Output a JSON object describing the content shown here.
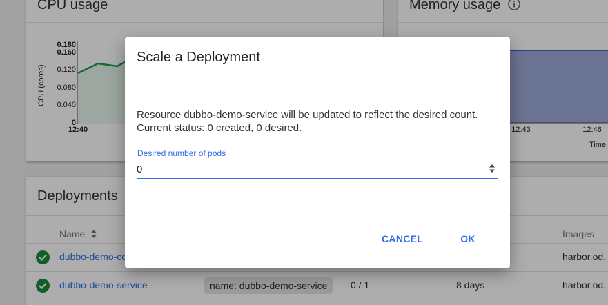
{
  "cpu": {
    "title": "CPU usage",
    "y_axis_label": "CPU (cores)",
    "y_ticks": [
      "0.180",
      "0.160",
      "0.120",
      "0.080",
      "0.040",
      "0"
    ],
    "x_tick_first": "12:40",
    "line_color": "#1b9e4b"
  },
  "memory": {
    "title": "Memory usage",
    "info_icon": "info-icon",
    "x_ticks": [
      "12:43",
      "12:46"
    ],
    "x_axis_label": "Time",
    "fill_color": "#9cacd8",
    "line_color": "#3f5fcc"
  },
  "deployments": {
    "title": "Deployments",
    "columns": {
      "name": "Name",
      "images": "Images"
    },
    "sort_icon": "sort-icon",
    "rows": [
      {
        "status_icon": "check-circle-icon",
        "name": "dubbo-demo-co",
        "label": "",
        "pods": "",
        "age": "",
        "images": "harbor.od."
      },
      {
        "status_icon": "check-circle-icon",
        "name": "dubbo-demo-service",
        "label": "name: dubbo-demo-service",
        "pods": "0 / 1",
        "age": "8 days",
        "images": "harbor.od."
      }
    ]
  },
  "dialog": {
    "title": "Scale a Deployment",
    "message_line1": "Resource dubbo-demo-service will be updated to reflect the desired count.",
    "message_line2": "Current status: 0 created, 0 desired.",
    "field_label": "Desired number of pods",
    "field_value": "0",
    "cancel_label": "CANCEL",
    "ok_label": "OK",
    "accent_color": "#326de6"
  }
}
